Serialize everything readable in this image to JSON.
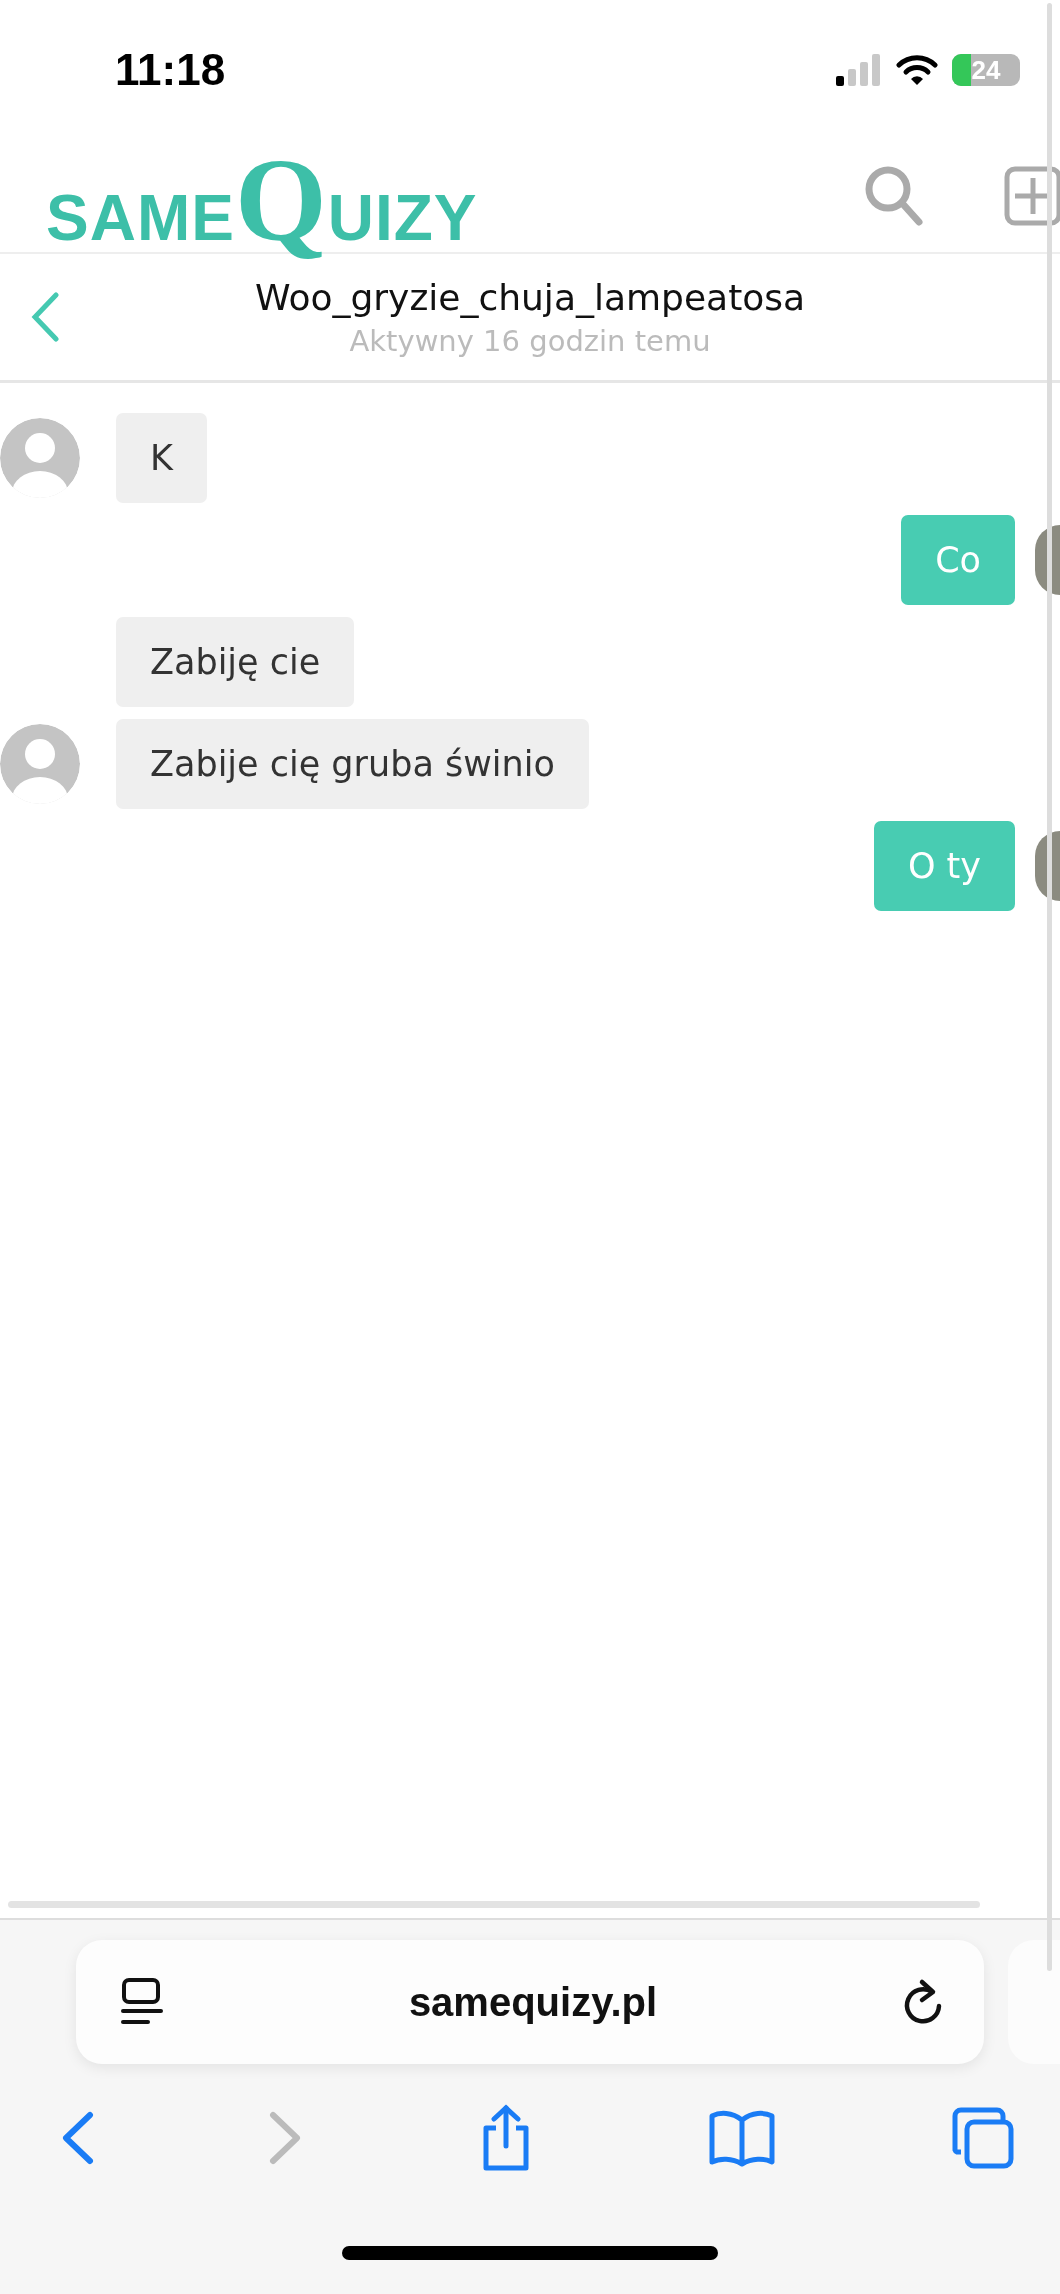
{
  "status_bar": {
    "time": "11:18",
    "battery": "24"
  },
  "site_header": {
    "logo_parts": [
      "SAME",
      "Q",
      "UIZY"
    ]
  },
  "conversation": {
    "title": "Woo_gryzie_chuja_lampeatosa",
    "subtitle": "Aktywny 16 godzin temu"
  },
  "messages": [
    {
      "kind": "incoming",
      "text": "K",
      "show_avatar": true
    },
    {
      "kind": "outgoing",
      "text": "Co",
      "show_avatar": true
    },
    {
      "kind": "incoming",
      "text": "Zabiję cie",
      "show_avatar": false
    },
    {
      "kind": "incoming",
      "text": "Zabije cię gruba świnio",
      "show_avatar": true
    },
    {
      "kind": "outgoing",
      "text": "O ty",
      "show_avatar": true
    }
  ],
  "browser": {
    "url": "samequizy.pl"
  }
}
